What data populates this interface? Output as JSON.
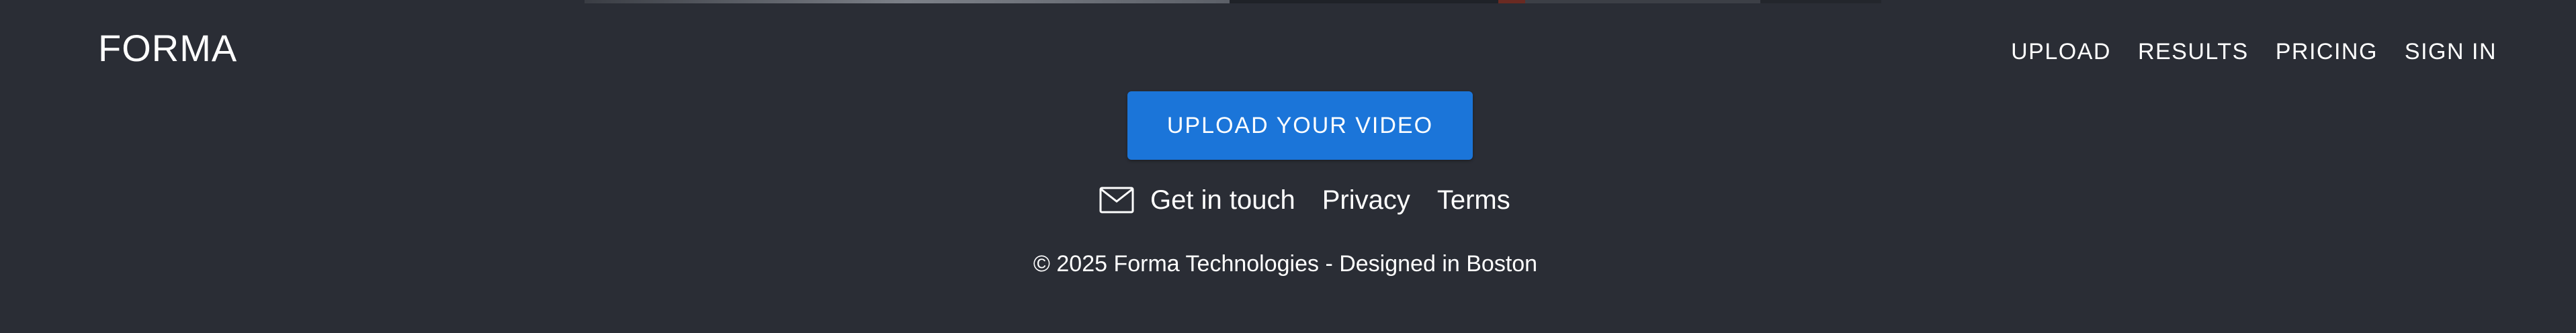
{
  "header": {
    "logo": "FORMA",
    "nav": [
      {
        "label": "UPLOAD"
      },
      {
        "label": "RESULTS"
      },
      {
        "label": "PRICING"
      },
      {
        "label": "SIGN IN"
      }
    ]
  },
  "cta": {
    "label": "UPLOAD YOUR VIDEO",
    "color": "#1b75d9"
  },
  "footer": {
    "contact_label": "Get in touch",
    "contact_icon": "mail-icon",
    "privacy_label": "Privacy",
    "terms_label": "Terms",
    "copyright": "© 2025 Forma Technologies - Designed in Boston"
  },
  "colors": {
    "background": "#2a2d35",
    "text": "#ffffff"
  }
}
